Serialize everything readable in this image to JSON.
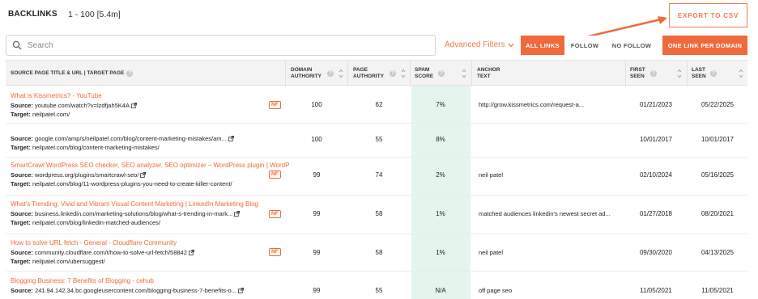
{
  "header": {
    "title": "BACKLINKS",
    "count": "1 - 100 [5.4m]",
    "export_label": "EXPORT TO CSV"
  },
  "toolbar": {
    "search_placeholder": "Search",
    "advanced_filters_label": "Advanced Filters",
    "segments": [
      {
        "label": "ALL LINKS",
        "active": true
      },
      {
        "label": "FOLLOW",
        "active": false
      },
      {
        "label": "NO FOLLOW",
        "active": false
      }
    ],
    "one_link_label": "ONE LINK PER DOMAIN"
  },
  "table": {
    "columns": [
      {
        "label": "SOURCE PAGE TITLE & URL | TARGET PAGE"
      },
      {
        "label": "DOMAIN AUTHORITY"
      },
      {
        "label": "PAGE AUTHORITY"
      },
      {
        "label": "SPAM SCORE"
      },
      {
        "label": "ANCHOR TEXT"
      },
      {
        "label": "FIRST SEEN"
      },
      {
        "label": "LAST SEEN"
      }
    ],
    "source_prefix": "Source:",
    "target_prefix": "Target:",
    "nf_badge": "NF",
    "rows": [
      {
        "title": "What is Kissmetrics? - YouTube",
        "source": "youtube.com/watch?v=lzdfjah5K4A",
        "target": "neilpatel.com/",
        "nf": true,
        "da": "100",
        "pa": "62",
        "spam": "7%",
        "anchor": "http://grow.kissmetrics.com/request-a...",
        "first": "01/21/2023",
        "last": "05/22/2025"
      },
      {
        "title": "",
        "source": "google.com/amp/s/neilpatel.com/blog/content-marketing-mistakes/am...",
        "target": "neilpatel.com/blog/content-marketing-mistakes/",
        "nf": false,
        "da": "100",
        "pa": "55",
        "spam": "8%",
        "anchor": "",
        "first": "10/01/2017",
        "last": "10/01/2017"
      },
      {
        "title": "SmartCrawl WordPress SEO checker, SEO analyzer, SEO optimizer – WordPress plugin | WordP",
        "source": "wordpress.org/plugins/smartcrawl-seo/",
        "target": "neilpatel.com/blog/11-wordpress-plugins-you-need-to-create-killer-content/",
        "nf": true,
        "da": "99",
        "pa": "74",
        "spam": "2%",
        "anchor": "neil patel",
        "first": "02/10/2024",
        "last": "05/16/2025"
      },
      {
        "title": "What's Trending: Vivid and Vibrant Visual Content Marketing | LinkedIn Marketing Blog",
        "source": "business.linkedin.com/marketing-solutions/blog/what-s-trending-in-mark...",
        "target": "neilpatel.com/blog/linkedin-matched-audiences/",
        "nf": true,
        "da": "99",
        "pa": "58",
        "spam": "1%",
        "anchor": "matched audiences linkedin's newest secret ad...",
        "first": "01/27/2018",
        "last": "08/20/2021"
      },
      {
        "title": "How to solve URL fetch - General - Cloudflare Community",
        "source": "community.cloudflare.com/t/how-to-solve-url-fetch/58842",
        "target": "neilpatel.com/ubersuggest/",
        "nf": true,
        "da": "99",
        "pa": "58",
        "spam": "1%",
        "anchor": "neil patel",
        "first": "09/30/2020",
        "last": "04/13/2025"
      },
      {
        "title": "Blogging Business: 7 Benefits of Blogging - cehub",
        "source": "241.94.142.34.bc.googleusercontent.com/blogging-business-7-benefits-o...",
        "target": "",
        "nf": false,
        "da": "99",
        "pa": "55",
        "spam": "N/A",
        "anchor": "off page seo",
        "first": "11/05/2021",
        "last": "11/05/2021"
      }
    ]
  },
  "colors": {
    "accent": "#ee6a3a",
    "spam_bg": "#e3f5ec"
  }
}
